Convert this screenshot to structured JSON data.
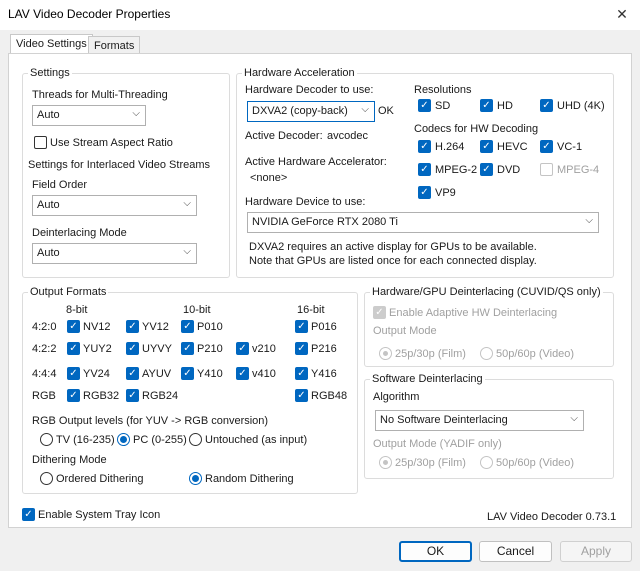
{
  "window": {
    "title": "LAV Video Decoder Properties",
    "close_glyph": "✕"
  },
  "tabs": [
    {
      "label": "Video Settings"
    },
    {
      "label": "Formats"
    }
  ],
  "settings": {
    "group_label": "Settings",
    "threads_label": "Threads for Multi-Threading",
    "threads_value": "Auto",
    "aspect_label": "Use Stream Aspect Ratio",
    "aspect_checked": false,
    "interlaced_label": "Settings for Interlaced Video Streams",
    "field_order_label": "Field Order",
    "field_order_value": "Auto",
    "deint_mode_label": "Deinterlacing Mode",
    "deint_mode_value": "Auto"
  },
  "hwaccel": {
    "group_label": "Hardware Acceleration",
    "decoder_label": "Hardware Decoder to use:",
    "decoder_value": "DXVA2 (copy-back)",
    "decoder_status": "OK",
    "active_decoder_label": "Active Decoder:",
    "active_decoder_value": "avcodec",
    "active_accel_label": "Active Hardware Accelerator:",
    "active_accel_value": "<none>",
    "device_label": "Hardware Device to use:",
    "device_value": "NVIDIA GeForce RTX 2080 Ti",
    "note_line1": "DXVA2 requires an active display for GPUs to be available.",
    "note_line2": "Note that GPUs are listed once for each connected display.",
    "resolutions_label": "Resolutions",
    "res_sd": "SD",
    "res_hd": "HD",
    "res_uhd": "UHD (4K)",
    "codecs_label": "Codecs for HW Decoding",
    "codec_h264": "H.264",
    "codec_hevc": "HEVC",
    "codec_vc1": "VC-1",
    "codec_mpeg2": "MPEG-2",
    "codec_dvd": "DVD",
    "codec_mpeg4": "MPEG-4",
    "codec_vp9": "VP9"
  },
  "output": {
    "group_label": "Output Formats",
    "col_8bit": "8-bit",
    "col_10bit": "10-bit",
    "col_16bit": "16-bit",
    "row_420": "4:2:0",
    "row_422": "4:2:2",
    "row_444": "4:4:4",
    "row_rgb": "RGB",
    "nv12": "NV12",
    "yv12": "YV12",
    "p010": "P010",
    "p016": "P016",
    "yuy2": "YUY2",
    "uyvy": "UYVY",
    "p210": "P210",
    "v210": "v210",
    "p216": "P216",
    "yv24": "YV24",
    "ayuv": "AYUV",
    "y410": "Y410",
    "v410": "v410",
    "y416": "Y416",
    "rgb32": "RGB32",
    "rgb24": "RGB24",
    "rgb48": "RGB48",
    "levels_label": "RGB Output levels (for YUV -> RGB conversion)",
    "tv": "TV (16-235)",
    "pc": "PC (0-255)",
    "untouched": "Untouched (as input)",
    "dither_label": "Dithering Mode",
    "ordered": "Ordered Dithering",
    "random": "Random Dithering"
  },
  "hwdeint": {
    "group_label": "Hardware/GPU Deinterlacing (CUVID/QS only)",
    "enable_label": "Enable Adaptive HW Deinterlacing",
    "output_mode_label": "Output Mode",
    "film": "25p/30p (Film)",
    "video": "50p/60p (Video)"
  },
  "swdeint": {
    "group_label": "Software Deinterlacing",
    "algorithm_label": "Algorithm",
    "algorithm_value": "No Software Deinterlacing",
    "output_mode_label": "Output Mode (YADIF only)",
    "film": "25p/30p (Film)",
    "video": "50p/60p (Video)"
  },
  "tray": {
    "label": "Enable System Tray Icon"
  },
  "version": "LAV Video Decoder 0.73.1",
  "buttons": {
    "ok": "OK",
    "cancel": "Cancel",
    "apply": "Apply"
  },
  "colors": {
    "accent": "#0067c0",
    "disabled": "#a0a0a0"
  }
}
